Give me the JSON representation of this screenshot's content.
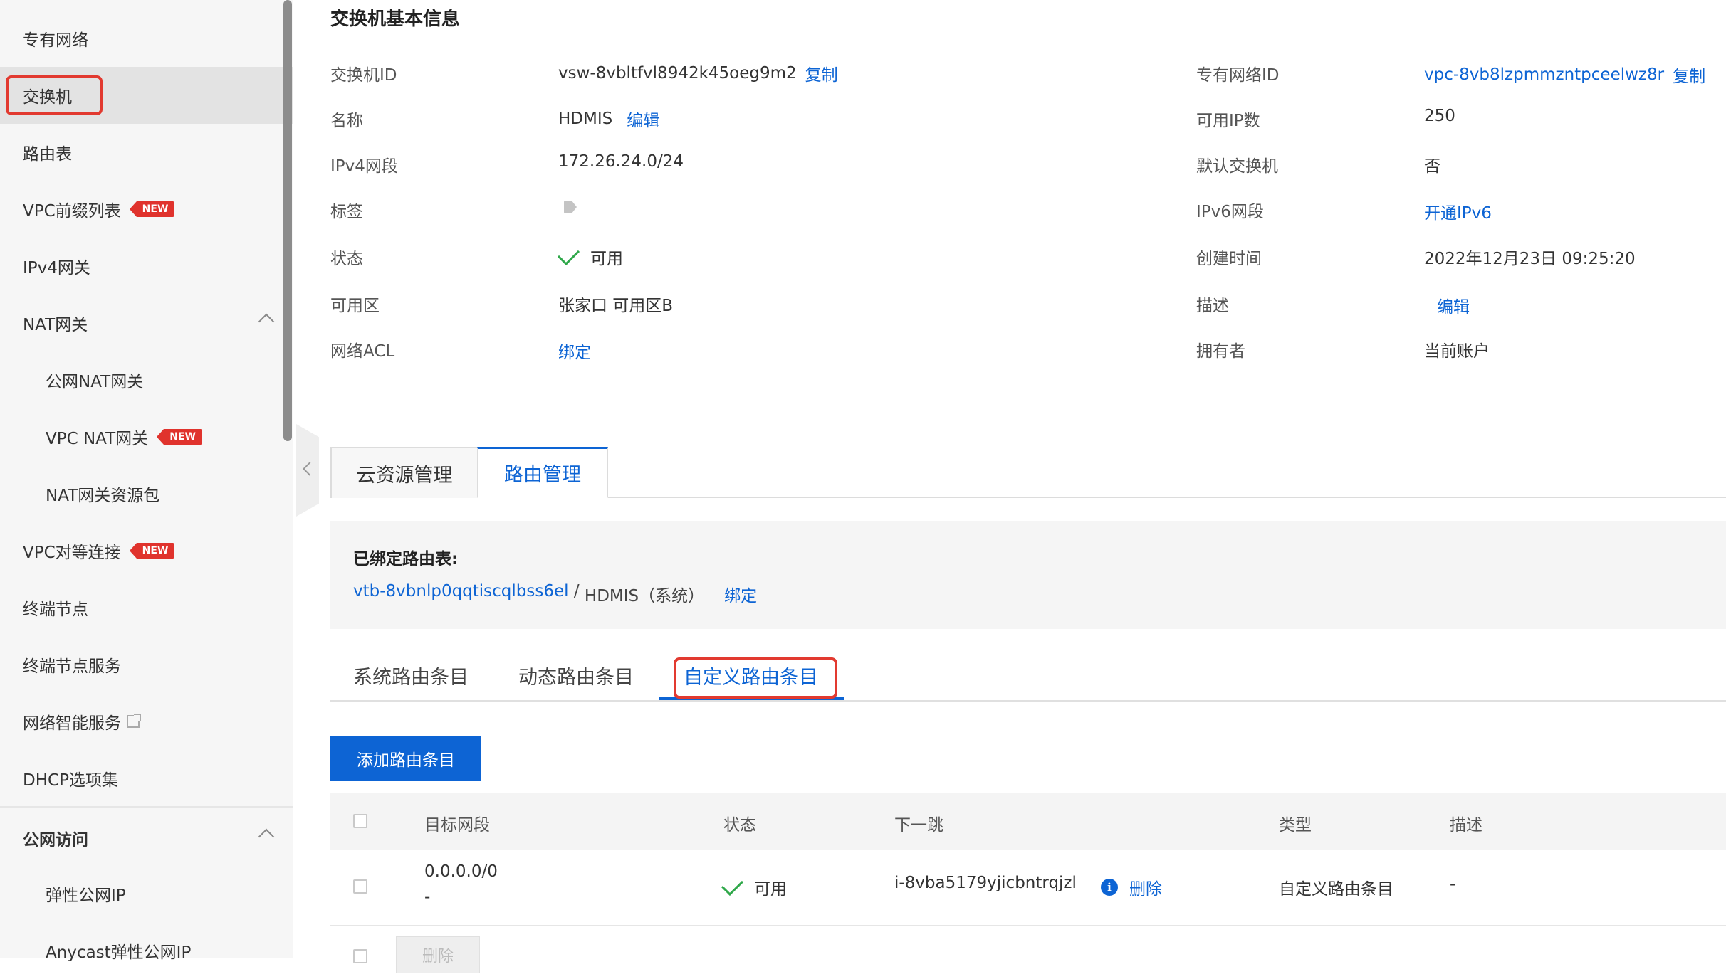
{
  "sidebar": {
    "items": [
      {
        "label": "专有网络"
      },
      {
        "label": "交换机"
      },
      {
        "label": "路由表"
      },
      {
        "label": "VPC前缀列表",
        "badge": "NEW"
      },
      {
        "label": "IPv4网关"
      },
      {
        "label": "NAT网关"
      },
      {
        "label": "公网NAT网关"
      },
      {
        "label": "VPC NAT网关",
        "badge": "NEW"
      },
      {
        "label": "NAT网关资源包"
      },
      {
        "label": "VPC对等连接",
        "badge": "NEW"
      },
      {
        "label": "终端节点"
      },
      {
        "label": "终端节点服务"
      },
      {
        "label": "网络智能服务"
      },
      {
        "label": "DHCP选项集"
      },
      {
        "label": "公网访问"
      },
      {
        "label": "弹性公网IP"
      },
      {
        "label": "Anycast弹性公网IP"
      }
    ]
  },
  "basic_info": {
    "title": "交换机基本信息",
    "left": [
      {
        "label": "交换机ID",
        "value": "vsw-8vbltfvl8942k45oeg9m2",
        "action": "复制"
      },
      {
        "label": "名称",
        "value": "HDMIS",
        "action": "编辑"
      },
      {
        "label": "IPv4网段",
        "value": "172.26.24.0/24"
      },
      {
        "label": "标签"
      },
      {
        "label": "状态",
        "value": "可用"
      },
      {
        "label": "可用区",
        "value": "张家口 可用区B"
      },
      {
        "label": "网络ACL",
        "action": "绑定"
      }
    ],
    "right": [
      {
        "label": "专有网络ID",
        "value": "vpc-8vb8lzpmmzntpceelwz8r",
        "action": "复制"
      },
      {
        "label": "可用IP数",
        "value": "250"
      },
      {
        "label": "默认交换机",
        "value": "否"
      },
      {
        "label": "IPv6网段",
        "action": "开通IPv6"
      },
      {
        "label": "创建时间",
        "value": "2022年12月23日 09:25:20"
      },
      {
        "label": "描述",
        "action": "编辑"
      },
      {
        "label": "拥有者",
        "value": "当前账户"
      }
    ]
  },
  "main_tabs": [
    {
      "label": "云资源管理"
    },
    {
      "label": "路由管理"
    }
  ],
  "route_table": {
    "title": "已绑定路由表:",
    "id": "vtb-8vbnlp0qqtiscqlbss6el",
    "separator": " / ",
    "name": "HDMIS（系统）",
    "action": "绑定"
  },
  "sub_tabs": [
    {
      "label": "系统路由条目"
    },
    {
      "label": "动态路由条目"
    },
    {
      "label": "自定义路由条目"
    }
  ],
  "add_button": "添加路由条目",
  "table": {
    "headers": [
      "目标网段",
      "状态",
      "下一跳",
      "类型",
      "描述"
    ],
    "rows": [
      {
        "dest": "0.0.0.0/0",
        "dest_sub": "-",
        "status": "可用",
        "next_hop": "i-8vba5179yjicbntrqjzl",
        "next_hop_action": "删除",
        "type": "自定义路由条目",
        "desc": "-"
      }
    ]
  },
  "delete_button": "删除",
  "colors": {
    "accent": "#0d64d4",
    "highlight": "#e23a30",
    "badge": "#e0332d",
    "ok": "#2fa84a"
  }
}
